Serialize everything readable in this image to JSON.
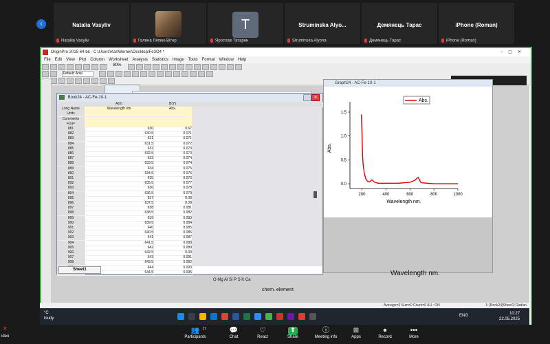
{
  "gallery": {
    "tiles": [
      {
        "name": "Natalia Vasyliv",
        "caption": "Nataliia Vasyliv"
      },
      {
        "name": "",
        "caption": "Галина Ляпюк-Вітер"
      },
      {
        "name": "T",
        "caption": "Ярослав Татарин"
      },
      {
        "name": "Struminska  Alyo...",
        "caption": "Struminska Alyona"
      },
      {
        "name": "Демянець Тарас",
        "caption": "Демянець Тарас"
      },
      {
        "name": "iPhone (Roman)",
        "caption": "iPhone (Roman)"
      }
    ]
  },
  "origin": {
    "title": "OriginPro 2015 64-bit - C:\\Users\\KarlWerner\\Desktop\\Fe3O4 *",
    "menu": [
      "File",
      "Edit",
      "View",
      "Plot",
      "Column",
      "Worksheet",
      "Analysis",
      "Statistics",
      "Image",
      "Tools",
      "Format",
      "Window",
      "Help"
    ],
    "zoom": "80%",
    "font": "Default: Arial",
    "book_title": "Book24 - AC-Fe-10-1",
    "sheet_tab": "Sheet1",
    "columns": {
      "a": "A(X)",
      "b": "B(Y)"
    },
    "row_labels": [
      "Long Name",
      "Units",
      "Comments",
      "F(x)="
    ],
    "long_name": {
      "a": "Wavelength nm",
      "b": "Abs."
    },
    "rows": [
      [
        "881",
        "630",
        "0.67"
      ],
      [
        "882",
        "630.5",
        "0.071"
      ],
      [
        "883",
        "631",
        "0.071"
      ],
      [
        "884",
        "631.5",
        "0.072"
      ],
      [
        "885",
        "632",
        "0.073"
      ],
      [
        "886",
        "632.5",
        "0.073"
      ],
      [
        "887",
        "633",
        "0.074"
      ],
      [
        "888",
        "633.5",
        "0.074"
      ],
      [
        "889",
        "634",
        "0.075"
      ],
      [
        "890",
        "634.5",
        "0.076"
      ],
      [
        "891",
        "635",
        "0.076"
      ],
      [
        "892",
        "635.5",
        "0.077"
      ],
      [
        "893",
        "636",
        "0.078"
      ],
      [
        "894",
        "636.5",
        "0.079"
      ],
      [
        "895",
        "637",
        "0.08"
      ],
      [
        "896",
        "637.5",
        "0.08"
      ],
      [
        "897",
        "638",
        "0.081"
      ],
      [
        "898",
        "638.5",
        "0.082"
      ],
      [
        "899",
        "639",
        "0.083"
      ],
      [
        "900",
        "639.5",
        "0.084"
      ],
      [
        "901",
        "640",
        "0.085"
      ],
      [
        "902",
        "640.5",
        "0.086"
      ],
      [
        "903",
        "641",
        "0.087"
      ],
      [
        "904",
        "641.5",
        "0.088"
      ],
      [
        "905",
        "642",
        "0.089"
      ],
      [
        "906",
        "642.5",
        "0.09"
      ],
      [
        "907",
        "643",
        "0.091"
      ],
      [
        "908",
        "643.5",
        "0.092"
      ],
      [
        "909",
        "644",
        "0.093"
      ],
      [
        "910",
        "644.5",
        "0.095"
      ]
    ],
    "graph_title": "Graph24 - AC-Fe-10-1",
    "legend": "Abs.",
    "ylabel": "Abs.",
    "xlabel": "Wavelength nm.",
    "wavelength_label_2": "Wavelength nm.",
    "elements": "O Mg Al Si P S K Ca",
    "chem_label": "chem. element",
    "status": "Average=0  Sum=0  Count=0  AU : ON",
    "status_right": "1: [Book24]Sheet1! Radian"
  },
  "chart_data": {
    "type": "line",
    "title": "",
    "xlabel": "Wavelength nm.",
    "ylabel": "Abs.",
    "xlim": [
      100,
      1000
    ],
    "ylim": [
      -0.1,
      1.6
    ],
    "xticks": [
      200,
      400,
      600,
      800,
      1000
    ],
    "yticks": [
      0.0,
      0.5,
      1.0,
      1.5
    ],
    "legend": "top-right",
    "series": [
      {
        "name": "Abs.",
        "color": "#e00000",
        "x": [
          195,
          200,
          205,
          210,
          220,
          230,
          240,
          250,
          260,
          270,
          280,
          290,
          300,
          320,
          340,
          360,
          380,
          400,
          450,
          500,
          550,
          600,
          620,
          640,
          650,
          660,
          670,
          680,
          690,
          700,
          750,
          800,
          850,
          900,
          950,
          1000
        ],
        "y": [
          1.45,
          1.1,
          0.6,
          0.4,
          0.22,
          0.12,
          0.07,
          0.05,
          0.04,
          0.05,
          0.08,
          0.07,
          0.04,
          0.02,
          0.01,
          0.01,
          0.01,
          0.01,
          0.01,
          0.01,
          0.02,
          0.03,
          0.05,
          0.07,
          0.09,
          0.12,
          0.13,
          0.08,
          0.03,
          0.02,
          0.01,
          0.0,
          0.0,
          0.0,
          0.0,
          0.0
        ]
      }
    ]
  },
  "taskbar": {
    "weather": "°C",
    "weather_sub": "loudy",
    "lang": "ENG",
    "time": "10:27",
    "date": "22.05.2025"
  },
  "zoom_controls": [
    {
      "label": "Participants",
      "glyph": "👥",
      "badge": "17"
    },
    {
      "label": "Chat",
      "glyph": "💬"
    },
    {
      "label": "React",
      "glyph": "♡"
    },
    {
      "label": "Share",
      "glyph": "⬆"
    },
    {
      "label": "Meeting info",
      "glyph": "ⓘ"
    },
    {
      "label": "Apps",
      "glyph": "⊞"
    },
    {
      "label": "Record",
      "glyph": "⏺"
    },
    {
      "label": "More",
      "glyph": "•••"
    }
  ],
  "video_label": "ideo"
}
